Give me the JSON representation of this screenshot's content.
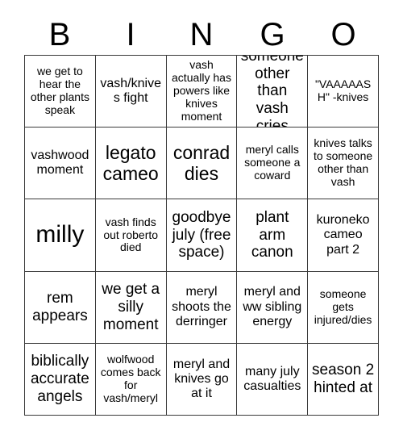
{
  "card": {
    "title_letters": [
      "B",
      "I",
      "N",
      "G",
      "O"
    ],
    "free_space_index": 12,
    "border_color": "#3a3a3a",
    "background_color": "#ffffff",
    "text_color": "#000000",
    "cells": [
      {
        "text": "we get to hear the other plants speak",
        "size": "sm"
      },
      {
        "text": "vash/knives fight",
        "size": "md"
      },
      {
        "text": "vash actually has powers like knives moment",
        "size": "sm"
      },
      {
        "text": "someone other than vash cries",
        "size": "lg"
      },
      {
        "text": "\"VAAAAASH\" -knives",
        "size": "sm"
      },
      {
        "text": "vashwood moment",
        "size": "md"
      },
      {
        "text": "legato cameo",
        "size": "xl"
      },
      {
        "text": "conrad dies",
        "size": "xl"
      },
      {
        "text": "meryl calls someone a coward",
        "size": "sm"
      },
      {
        "text": "knives talks to someone other than vash",
        "size": "sm"
      },
      {
        "text": "milly",
        "size": "xxl"
      },
      {
        "text": "vash finds out roberto died",
        "size": "sm"
      },
      {
        "text": "goodbye july (free space)",
        "size": "lg"
      },
      {
        "text": "plant arm canon",
        "size": "lg"
      },
      {
        "text": "kuroneko cameo part 2",
        "size": "md"
      },
      {
        "text": "rem appears",
        "size": "lg"
      },
      {
        "text": "we get a silly moment",
        "size": "lg"
      },
      {
        "text": "meryl shoots the derringer",
        "size": "md"
      },
      {
        "text": "meryl and ww sibling energy",
        "size": "md"
      },
      {
        "text": "someone gets injured/dies",
        "size": "sm"
      },
      {
        "text": "biblically accurate angels",
        "size": "lg"
      },
      {
        "text": "wolfwood comes back for vash/meryl",
        "size": "sm"
      },
      {
        "text": "meryl and knives go at it",
        "size": "md"
      },
      {
        "text": "many july casualties",
        "size": "md"
      },
      {
        "text": "season 2 hinted at",
        "size": "lg"
      }
    ]
  }
}
